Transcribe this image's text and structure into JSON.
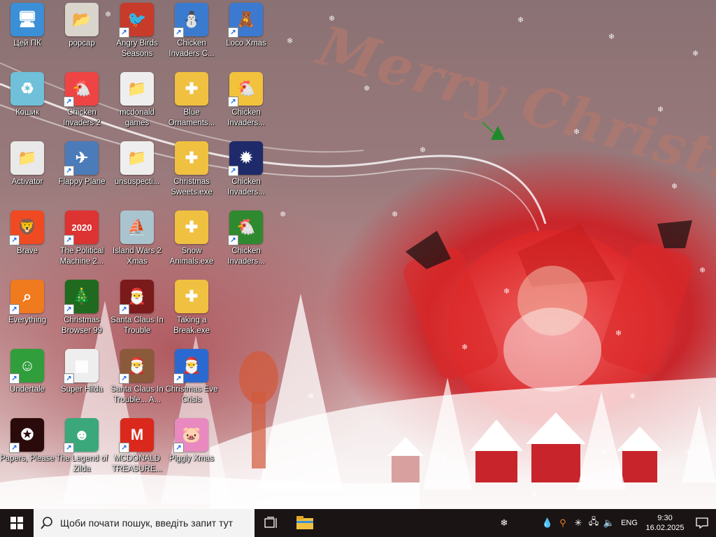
{
  "wallpaper": {
    "text": "Merry Christmas"
  },
  "desktop_icons": [
    {
      "label": "Цей ПК",
      "icon": "computer-icon",
      "color": "#3b8fd6",
      "glyph": "🖥",
      "shortcut": false
    },
    {
      "label": "Кошик",
      "icon": "recycle-bin-icon",
      "color": "#6fc0d8",
      "glyph": "♻",
      "shortcut": false
    },
    {
      "label": "Activator",
      "icon": "folder-icon",
      "color": "#e9e9e9",
      "glyph": "📁",
      "shortcut": false
    },
    {
      "label": "Brave",
      "icon": "brave-icon",
      "color": "#f04a23",
      "glyph": "🦁",
      "shortcut": true
    },
    {
      "label": "Everything",
      "icon": "search-app-icon",
      "color": "#f07a1e",
      "glyph": "⌕",
      "shortcut": true
    },
    {
      "label": "Undertale",
      "icon": "undertale-icon",
      "color": "#2f9e3b",
      "glyph": "☺",
      "shortcut": true
    },
    {
      "label": "Papers, Please",
      "icon": "papers-please-icon",
      "color": "#2a0a0a",
      "glyph": "✪",
      "shortcut": true
    },
    {
      "label": "popcap",
      "icon": "popcap-folder-icon",
      "color": "#d9d4cc",
      "glyph": "📂",
      "shortcut": false
    },
    {
      "label": "Chicken Invaders 2",
      "icon": "chicken-invaders-icon",
      "color": "#e44",
      "glyph": "🐔",
      "shortcut": true
    },
    {
      "label": "Flappy Plane",
      "icon": "flappy-plane-icon",
      "color": "#4b7bb8",
      "glyph": "✈",
      "shortcut": true
    },
    {
      "label": "The Political Machine 2...",
      "icon": "political-machine-icon",
      "color": "#d33",
      "glyph": "2020",
      "shortcut": true
    },
    {
      "label": "Christmas Browser 99",
      "icon": "christmas-tree-icon",
      "color": "#1f6a1f",
      "glyph": "🎄",
      "shortcut": true
    },
    {
      "label": "Super Hilda",
      "icon": "super-hilda-icon",
      "color": "#eeeeee",
      "glyph": "▦",
      "shortcut": true
    },
    {
      "label": "The Legend of Zilda",
      "icon": "zilda-icon",
      "color": "#3aa87a",
      "glyph": "☻",
      "shortcut": true
    },
    {
      "label": "Angry Birds Seasons",
      "icon": "angry-birds-icon",
      "color": "#c83a2a",
      "glyph": "🐦",
      "shortcut": true
    },
    {
      "label": "mcdonald games",
      "icon": "folder-icon",
      "color": "#eeeeee",
      "glyph": "📁",
      "shortcut": false
    },
    {
      "label": "unsuspecti...",
      "icon": "folder-icon",
      "color": "#eeeeee",
      "glyph": "📁",
      "shortcut": false
    },
    {
      "label": "Island Wars 2 Xmas",
      "icon": "island-wars-icon",
      "color": "#a9c4cf",
      "glyph": "⛵",
      "shortcut": false
    },
    {
      "label": "Santa Claus In Trouble",
      "icon": "santa-claus-icon",
      "color": "#7a1a1a",
      "glyph": "🎅",
      "shortcut": true
    },
    {
      "label": "Santa Claus In Trouble... A...",
      "icon": "santa-claus-icon",
      "color": "#8a5a3a",
      "glyph": "🎅",
      "shortcut": true
    },
    {
      "label": "MCDONALD TREASURE...",
      "icon": "mcdonalds-icon",
      "color": "#da291c",
      "glyph": "M",
      "shortcut": true
    },
    {
      "label": "Chicken Invaders C...",
      "icon": "chicken-invaders-icon",
      "color": "#3a7bd0",
      "glyph": "⛄",
      "shortcut": true
    },
    {
      "label": "Blue Ornaments...",
      "icon": "exe-file-icon",
      "color": "#f0c040",
      "glyph": "✚",
      "shortcut": false
    },
    {
      "label": "Christmas Sweets.exe",
      "icon": "exe-file-icon",
      "color": "#f0c040",
      "glyph": "✚",
      "shortcut": false
    },
    {
      "label": "Snow Animals.exe",
      "icon": "exe-file-icon",
      "color": "#f0c040",
      "glyph": "✚",
      "shortcut": false
    },
    {
      "label": "Taking a Break.exe",
      "icon": "exe-file-icon",
      "color": "#f0c040",
      "glyph": "✚",
      "shortcut": false
    },
    {
      "label": "Christmas Eve Crisis",
      "icon": "santa-face-icon",
      "color": "#2a6ad0",
      "glyph": "🎅",
      "shortcut": true
    },
    {
      "label": "Piggly Xmas",
      "icon": "piggly-icon",
      "color": "#e88ac0",
      "glyph": "🐷",
      "shortcut": true
    },
    {
      "label": "Loco Xmas",
      "icon": "loco-xmas-icon",
      "color": "#3b7ad0",
      "glyph": "🧸",
      "shortcut": true
    },
    {
      "label": "Chicken Invaders...",
      "icon": "chicken-invaders-icon",
      "color": "#f2c23c",
      "glyph": "🐔",
      "shortcut": true
    },
    {
      "label": "Chicken Invaders...",
      "icon": "chicken-invaders-icon",
      "color": "#1e2a6a",
      "glyph": "✹",
      "shortcut": true
    },
    {
      "label": "Chicken Invaders...",
      "icon": "chicken-invaders-icon",
      "color": "#2f8a2f",
      "glyph": "🐔",
      "shortcut": true
    }
  ],
  "taskbar": {
    "search_placeholder": "Щоби почати пошук, введіть запит тут",
    "language": "ENG",
    "time": "9:30",
    "date": "16.02.2025"
  },
  "colors": {
    "taskbar_bg": "#1a1414",
    "search_bg": "#f3f3f3",
    "start_blue": "#ffffff"
  }
}
